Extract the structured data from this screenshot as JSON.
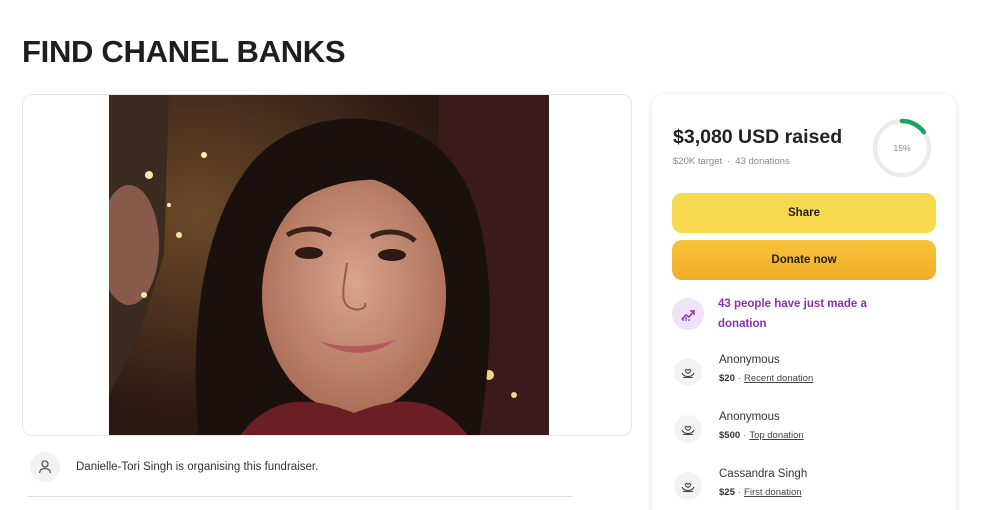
{
  "page": {
    "title": "FIND CHANEL BANKS"
  },
  "organiser": {
    "text": "Danielle-Tori Singh is organising this fundraiser."
  },
  "stats": {
    "raised": "$3,080 USD raised",
    "target": "$20K target",
    "separator": "·",
    "donations": "43 donations",
    "progress_label": "15%",
    "progress_fraction": 0.15
  },
  "buttons": {
    "share": "Share",
    "donate": "Donate now"
  },
  "trend": {
    "text": "43 people have just made a donation"
  },
  "donations": [
    {
      "name": "Anonymous",
      "amount": "$20",
      "tag": "Recent donation"
    },
    {
      "name": "Anonymous",
      "amount": "$500",
      "tag": "Top donation"
    },
    {
      "name": "Cassandra Singh",
      "amount": "$25",
      "tag": "First donation"
    }
  ],
  "colors": {
    "accent_purple": "#8a2fb3",
    "progress_green": "#1aa35a",
    "share_yellow": "#f6d94e",
    "donate_orange": "#f2ac28"
  },
  "icons": {
    "organiser": "person-icon",
    "trend": "trending-up-icon",
    "donor": "heart-hands-icon"
  }
}
